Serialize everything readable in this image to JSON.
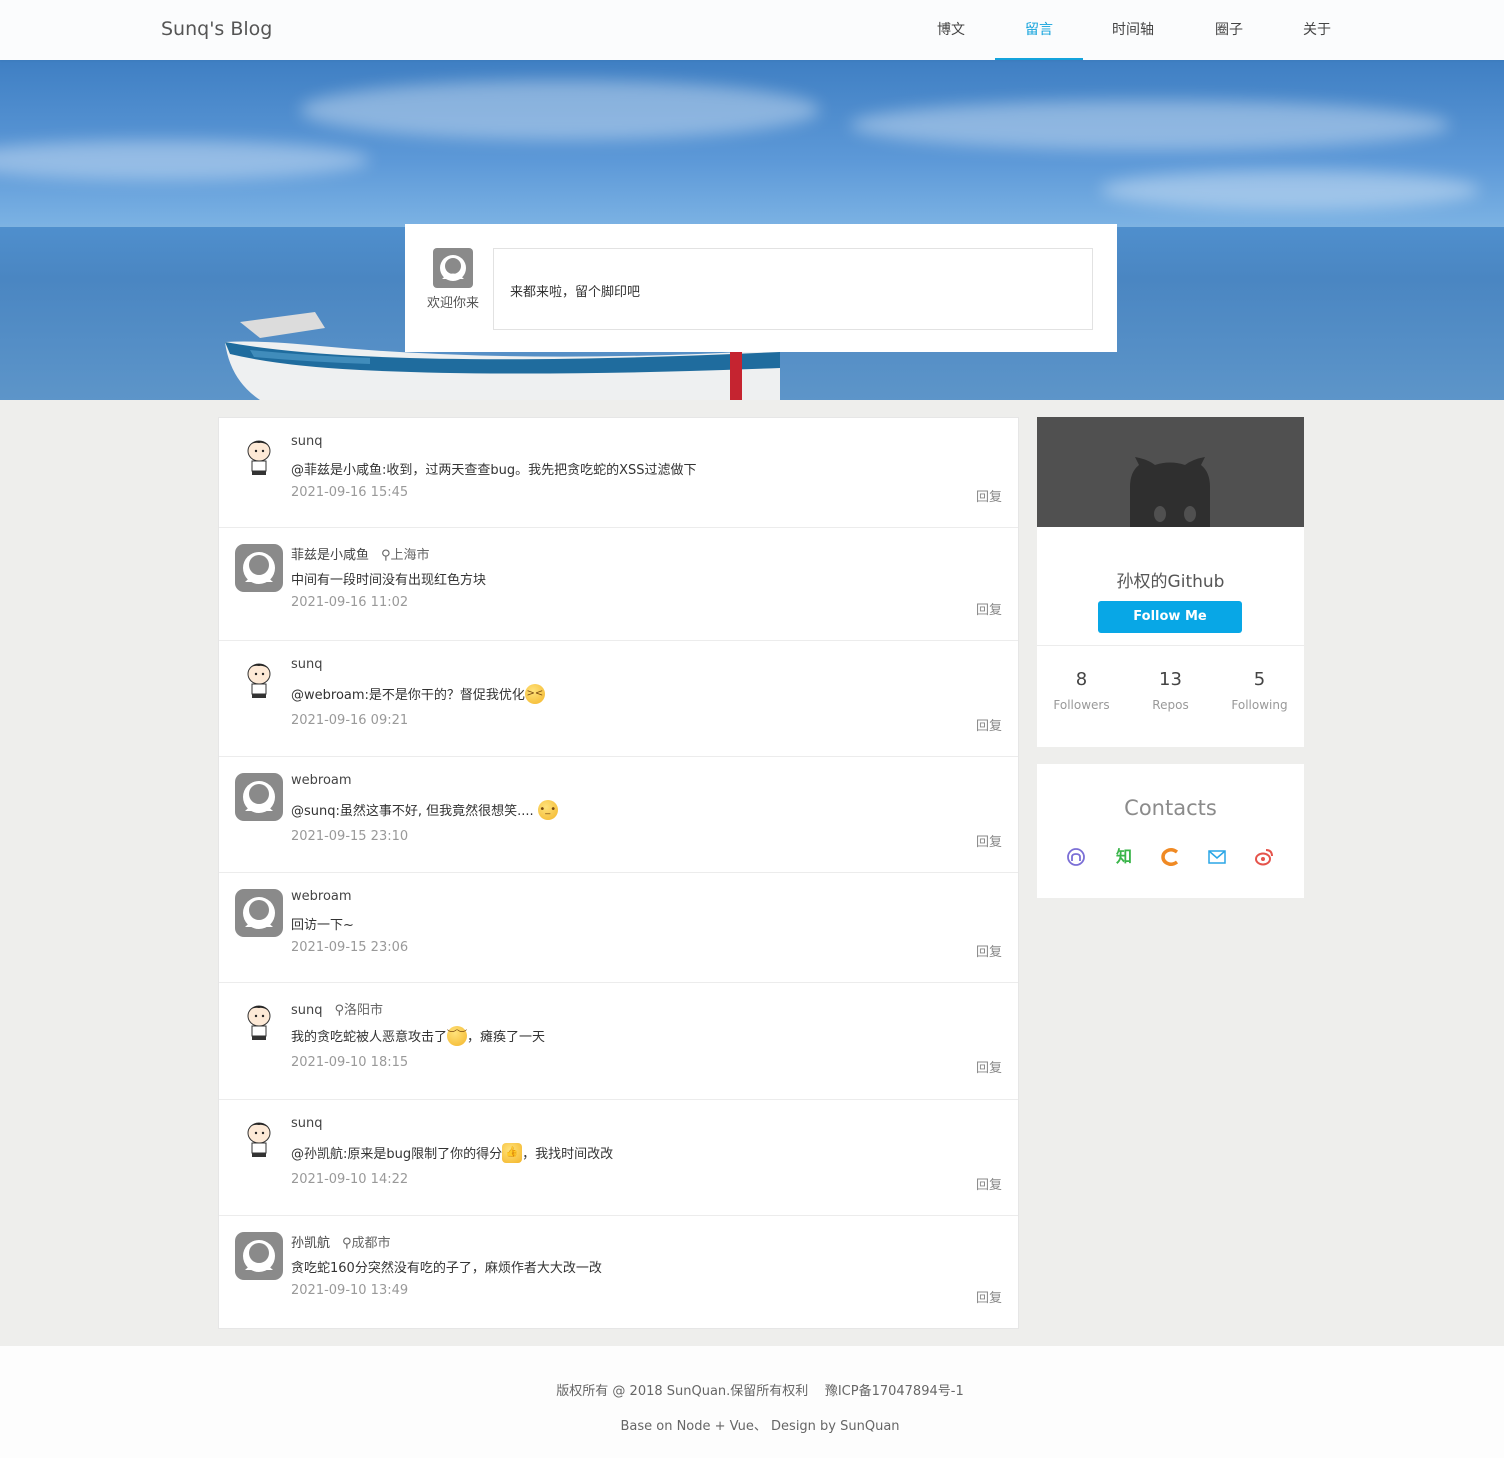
{
  "header": {
    "brand": "Sunq's Blog",
    "nav": [
      {
        "label": "博文"
      },
      {
        "label": "留言"
      },
      {
        "label": "时间轴"
      },
      {
        "label": "圈子"
      },
      {
        "label": "关于"
      }
    ],
    "active_nav": "留言",
    "accent_color": "#14a3dc"
  },
  "composer": {
    "welcome": "欢迎你来",
    "placeholder": "来都来啦，留个脚印吧"
  },
  "comments": [
    {
      "name": "sunq",
      "location": "",
      "text": "@菲兹是小咸鱼:收到，过两天查查bug。我先把贪吃蛇的XSS过滤做下",
      "emoji": "",
      "text_after": "",
      "time": "2021-09-16 15:45",
      "reply": "回复",
      "avatar": "cartoon"
    },
    {
      "name": "菲兹是小咸鱼",
      "location": "上海市",
      "text": "中间有一段时间没有出现红色方块",
      "emoji": "",
      "text_after": "",
      "time": "2021-09-16 11:02",
      "reply": "回复",
      "avatar": "default"
    },
    {
      "name": "sunq",
      "location": "",
      "text": "@webroam:是不是你干的？督促我优化",
      "emoji": "shocked-emoji",
      "text_after": "",
      "time": "2021-09-16 09:21",
      "reply": "回复",
      "avatar": "cartoon"
    },
    {
      "name": "webroam",
      "location": "",
      "text": "@sunq:虽然这事不好, 但我竟然很想笑.... ",
      "emoji": "thinking-emoji",
      "text_after": "",
      "time": "2021-09-15 23:10",
      "reply": "回复",
      "avatar": "default"
    },
    {
      "name": "webroam",
      "location": "",
      "text": "回访一下~",
      "emoji": "",
      "text_after": "",
      "time": "2021-09-15 23:06",
      "reply": "回复",
      "avatar": "default"
    },
    {
      "name": "sunq",
      "location": "洛阳市",
      "text": "我的贪吃蛇被人恶意攻击了",
      "emoji": "relieved-emoji",
      "text_after": "，瘫痪了一天",
      "time": "2021-09-10 18:15",
      "reply": "回复",
      "avatar": "cartoon"
    },
    {
      "name": "sunq",
      "location": "",
      "text": "@孙凯航:原来是bug限制了你的得分",
      "emoji": "thumbs-up-emoji",
      "text_after": "，我找时间改改",
      "time": "2021-09-10 14:22",
      "reply": "回复",
      "avatar": "cartoon"
    },
    {
      "name": "孙凯航",
      "location": "成都市",
      "text": "贪吃蛇160分突然没有吃的子了，麻烦作者大大改一改",
      "emoji": "",
      "text_after": "",
      "time": "2021-09-10 13:49",
      "reply": "回复",
      "avatar": "default"
    }
  ],
  "github": {
    "title": "孙权的Github",
    "follow_label": "Follow Me",
    "button_color": "#08a7e6",
    "stats": [
      {
        "value": "8",
        "label": "Followers"
      },
      {
        "value": "13",
        "label": "Repos"
      },
      {
        "value": "5",
        "label": "Following"
      }
    ]
  },
  "contacts": {
    "title": "Contacts",
    "icons": [
      {
        "name": "github-icon",
        "color": "#7b6fd6"
      },
      {
        "name": "zhihu-icon",
        "color": "#3ab54a",
        "text": "知"
      },
      {
        "name": "csdn-icon",
        "color": "#f08a24"
      },
      {
        "name": "mail-icon",
        "color": "#2aa6e6"
      },
      {
        "name": "weibo-icon",
        "color": "#e5534b"
      }
    ]
  },
  "footer": {
    "copyright": "版权所有 @ 2018 SunQuan.保留所有权利    豫ICP备17047894号-1",
    "credit": "Base on Node + Vue、 Design by SunQuan"
  }
}
